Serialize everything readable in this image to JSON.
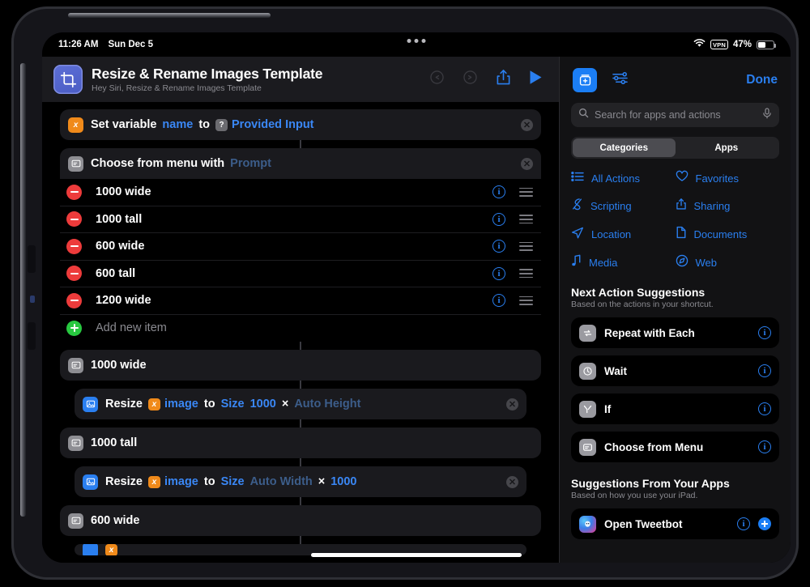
{
  "status_bar": {
    "time": "11:26 AM",
    "date": "Sun Dec 5",
    "battery_percent": "47%",
    "wifi_icon": "wifi-icon",
    "vpn_label": "VPN",
    "multitask_icon": "multitask-handle-icon"
  },
  "editor": {
    "icon": "crop-icon",
    "title": "Resize & Rename Images Template",
    "subtitle": "Hey Siri, Resize & Rename Images Template",
    "undo_icon": "undo-icon",
    "redo_icon": "redo-icon",
    "share_icon": "share-icon",
    "play_icon": "play-icon",
    "actions": [
      {
        "id": "set-variable",
        "icon": "variable-icon",
        "icon_glyph": "x",
        "icon_color": "#f08a1a",
        "parts": [
          {
            "type": "white",
            "text": "Set variable"
          },
          {
            "type": "blue",
            "text": "name"
          },
          {
            "type": "white",
            "text": "to"
          },
          {
            "type": "chip-q",
            "chip": "?",
            "text": "Provided Input"
          }
        ],
        "has_close": true
      },
      {
        "id": "choose-from-menu",
        "icon": "menu-icon",
        "icon_color": "#8e8e93",
        "parts": [
          {
            "type": "white",
            "text": "Choose from menu with"
          },
          {
            "type": "dim",
            "text": "Prompt"
          }
        ],
        "has_close": true
      }
    ],
    "menu_items": [
      {
        "label": "1000 wide",
        "info_icon": "info-icon",
        "grip_icon": "reorder-grip-icon"
      },
      {
        "label": "1000 tall",
        "info_icon": "info-icon",
        "grip_icon": "reorder-grip-icon"
      },
      {
        "label": "600 wide",
        "info_icon": "info-icon",
        "grip_icon": "reorder-grip-icon"
      },
      {
        "label": "600 tall",
        "info_icon": "info-icon",
        "grip_icon": "reorder-grip-icon"
      },
      {
        "label": "1200 wide",
        "info_icon": "info-icon",
        "grip_icon": "reorder-grip-icon"
      }
    ],
    "add_new_item_label": "Add new item",
    "branches": [
      {
        "label": "1000 wide",
        "icon": "menu-icon"
      },
      {
        "label": "1000 tall",
        "icon": "menu-icon"
      },
      {
        "label": "600 wide",
        "icon": "menu-icon"
      }
    ],
    "resize_actions": [
      {
        "icon": "resize-image-icon",
        "verb": "Resize",
        "chip_var": "image",
        "to": "to",
        "size_label": "Size",
        "width": "1000",
        "times": "×",
        "height": "Auto Height",
        "width_dim": false,
        "height_dim": true
      },
      {
        "icon": "resize-image-icon",
        "verb": "Resize",
        "chip_var": "image",
        "to": "to",
        "size_label": "Size",
        "width": "Auto Width",
        "times": "×",
        "height": "1000",
        "width_dim": true,
        "height_dim": false
      }
    ]
  },
  "library": {
    "add_action_icon": "add-action-icon",
    "settings_icon": "sliders-icon",
    "done_label": "Done",
    "search": {
      "placeholder": "Search for apps and actions",
      "search_icon": "search-icon",
      "mic_icon": "microphone-icon"
    },
    "segments": [
      {
        "label": "Categories",
        "active": true
      },
      {
        "label": "Apps",
        "active": false
      }
    ],
    "categories": [
      {
        "label": "All Actions",
        "icon": "list-icon"
      },
      {
        "label": "Favorites",
        "icon": "heart-icon"
      },
      {
        "label": "Scripting",
        "icon": "scripting-icon"
      },
      {
        "label": "Sharing",
        "icon": "share-icon"
      },
      {
        "label": "Location",
        "icon": "location-arrow-icon"
      },
      {
        "label": "Documents",
        "icon": "document-icon"
      },
      {
        "label": "Media",
        "icon": "music-note-icon"
      },
      {
        "label": "Web",
        "icon": "compass-icon"
      }
    ],
    "next_action_suggestions": {
      "title": "Next Action Suggestions",
      "subtitle": "Based on the actions in your shortcut.",
      "items": [
        {
          "label": "Repeat with Each",
          "icon": "repeat-icon",
          "info_icon": "info-icon"
        },
        {
          "label": "Wait",
          "icon": "clock-icon",
          "info_icon": "info-icon"
        },
        {
          "label": "If",
          "icon": "branch-icon",
          "info_icon": "info-icon"
        },
        {
          "label": "Choose from Menu",
          "icon": "menu-icon",
          "info_icon": "info-icon"
        }
      ]
    },
    "app_suggestions": {
      "title": "Suggestions From Your Apps",
      "subtitle": "Based on how you use your iPad.",
      "items": [
        {
          "label": "Open Tweetbot",
          "icon": "tweetbot-app-icon",
          "info_icon": "info-icon",
          "add_icon": "add-icon"
        }
      ]
    }
  },
  "colors": {
    "accent_blue": "#2a7ff0",
    "dim_blue": "#3c5d8a",
    "orange": "#f08a1a",
    "red": "#ed3b3b",
    "green": "#28c840"
  }
}
